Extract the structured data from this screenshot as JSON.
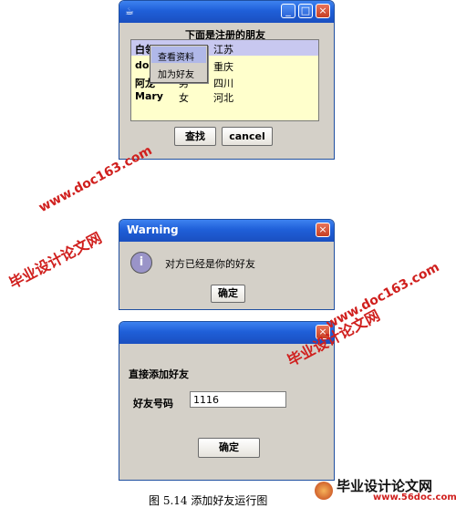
{
  "friends_window": {
    "heading": "下面是注册的朋友",
    "rows": [
      {
        "name": "白领",
        "gender": "",
        "region": "江苏"
      },
      {
        "name": "dou",
        "gender": "",
        "region": "重庆"
      },
      {
        "name": "阿龙",
        "gender": "男",
        "region": "四川"
      },
      {
        "name": "Mary",
        "gender": "女",
        "region": "河北"
      }
    ],
    "context_menu": [
      "查看资料",
      "加为好友"
    ],
    "search_button": "查找",
    "cancel_button": "cancel"
  },
  "warning_dialog": {
    "title": "Warning",
    "message": "对方已经是你的好友",
    "ok_button": "确定"
  },
  "add_friend_dialog": {
    "heading": "直接添加好友",
    "field_label": "好友号码",
    "field_value": "1116",
    "ok_button": "确定"
  },
  "watermarks": {
    "site_url": "www.doc163.com",
    "site_name": "毕业设计论文网",
    "footer_url": "www.56doc.com"
  },
  "caption": "图 5.14  添加好友运行图",
  "colors": {
    "titlebar": "#1f5fd8",
    "list_bg": "#ffffcc",
    "selected_row": "#c8c8f0",
    "watermark": "#d0201e"
  }
}
